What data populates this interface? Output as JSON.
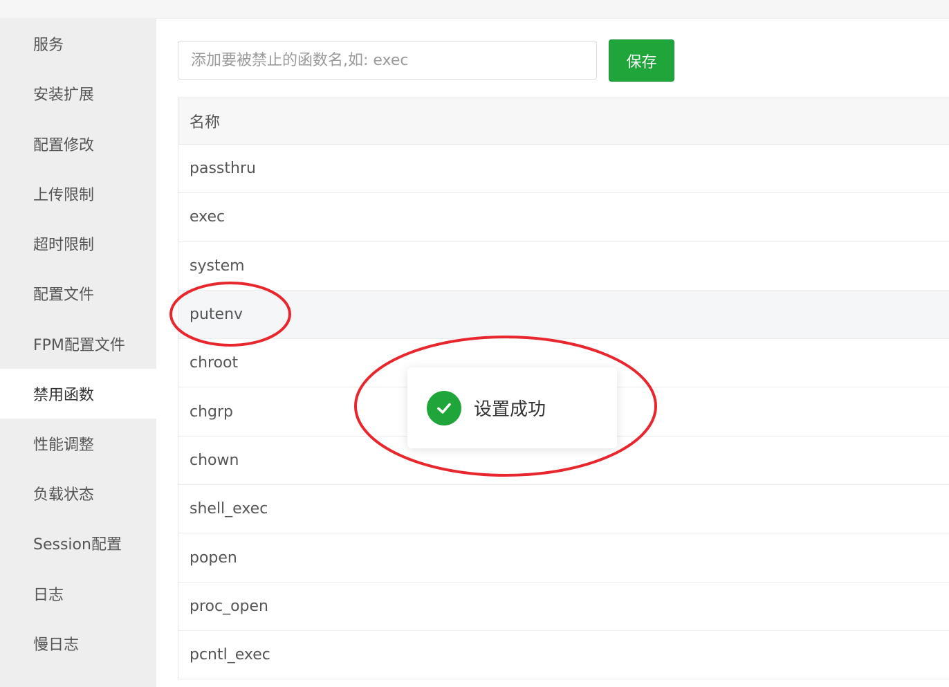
{
  "sidebar": {
    "items": [
      {
        "label": "服务"
      },
      {
        "label": "安装扩展"
      },
      {
        "label": "配置修改"
      },
      {
        "label": "上传限制"
      },
      {
        "label": "超时限制"
      },
      {
        "label": "配置文件"
      },
      {
        "label": "FPM配置文件"
      },
      {
        "label": "禁用函数",
        "active": true
      },
      {
        "label": "性能调整"
      },
      {
        "label": "负载状态"
      },
      {
        "label": "Session配置"
      },
      {
        "label": "日志"
      },
      {
        "label": "慢日志"
      }
    ]
  },
  "main": {
    "input_placeholder": "添加要被禁止的函数名,如: exec",
    "save_label": "保存",
    "table": {
      "header": "名称",
      "rows": [
        "passthru",
        "exec",
        "system",
        "putenv",
        "chroot",
        "chgrp",
        "chown",
        "shell_exec",
        "popen",
        "proc_open",
        "pcntl_exec"
      ]
    }
  },
  "toast": {
    "message": "设置成功",
    "icon": "check-circle-icon"
  },
  "colors": {
    "accent": "#20a53a",
    "annotation": "#e8262e"
  }
}
